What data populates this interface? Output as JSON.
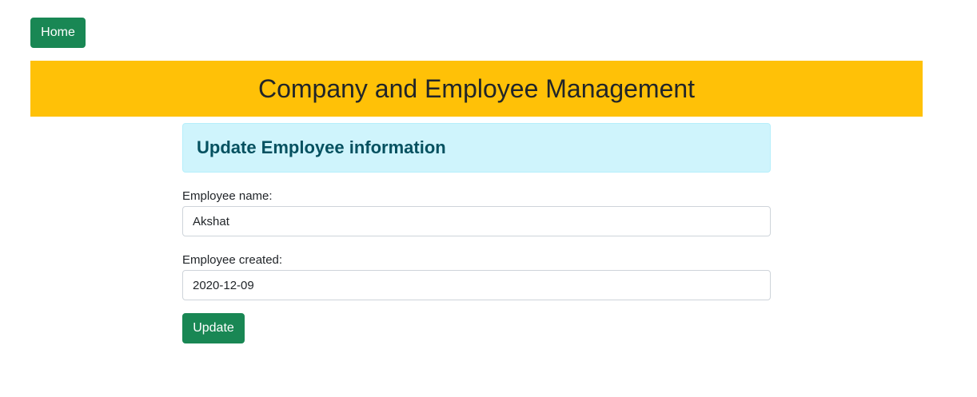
{
  "nav": {
    "home_label": "Home"
  },
  "header": {
    "title": "Company and Employee Management"
  },
  "form": {
    "heading": "Update Employee information",
    "fields": [
      {
        "label": "Employee name:",
        "value": "Akshat"
      },
      {
        "label": "Employee created:",
        "value": "2020-12-09"
      }
    ],
    "submit_label": "Update"
  },
  "colors": {
    "primary_button": "#198754",
    "banner": "#ffc107",
    "info_alert_bg": "#cff4fc",
    "info_alert_text": "#055160"
  }
}
